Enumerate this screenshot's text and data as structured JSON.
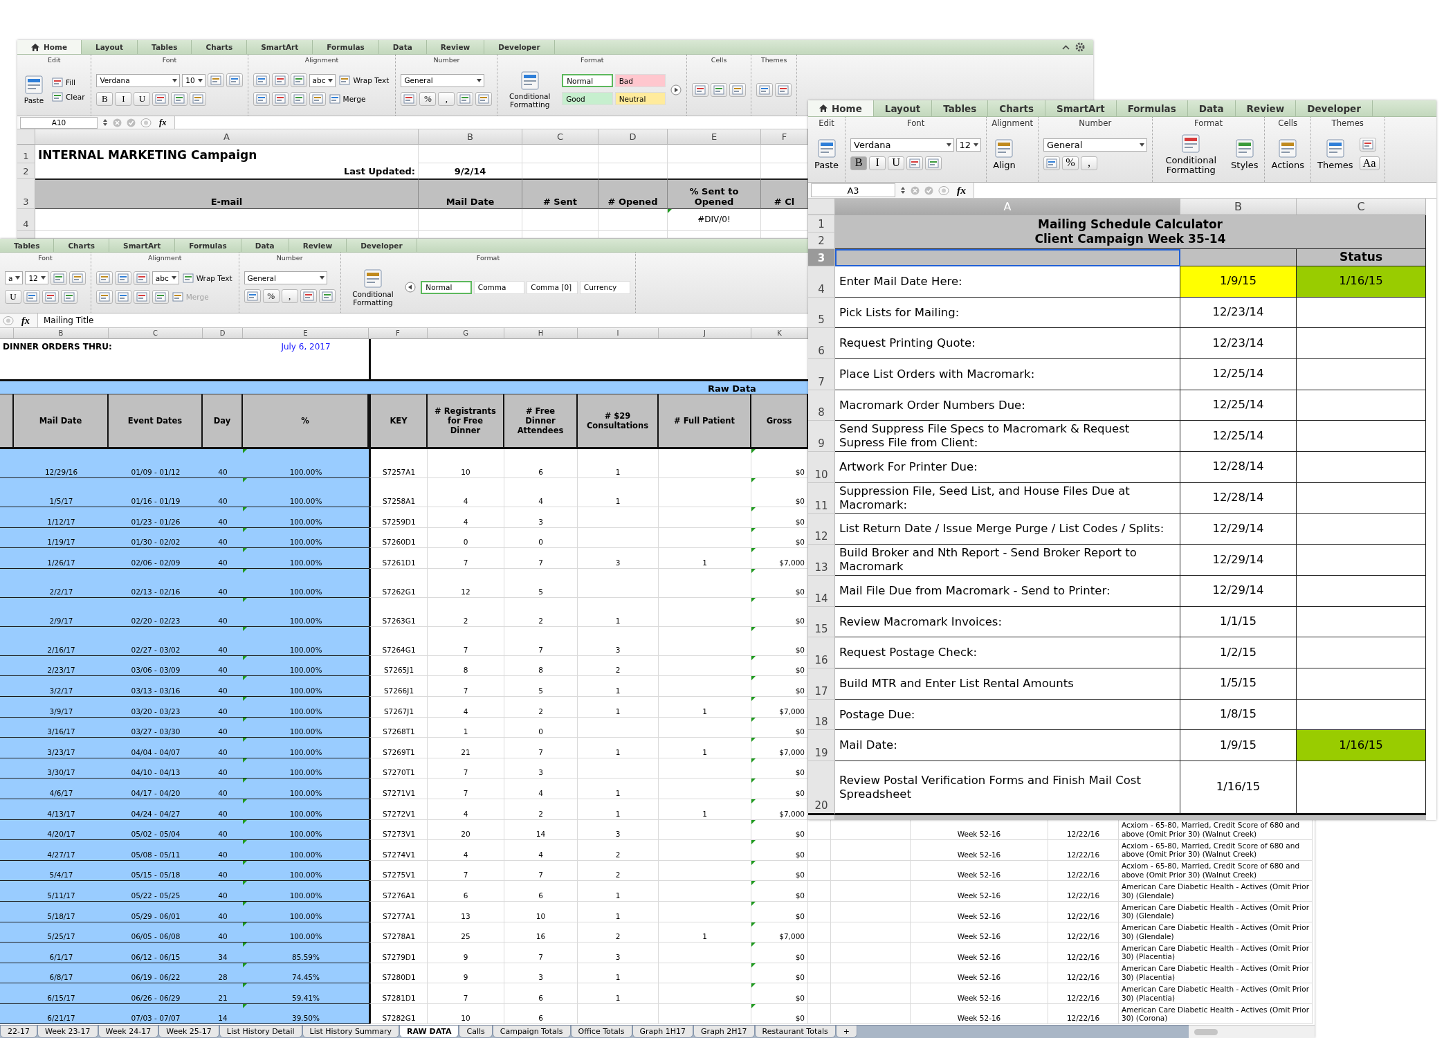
{
  "marketing_window": {
    "tabs": [
      {
        "label": "Home",
        "kind": "home",
        "selected": true
      },
      {
        "label": "Layout",
        "kind": "plain",
        "selected": false
      },
      {
        "label": "Tables",
        "kind": "plain",
        "selected": false
      },
      {
        "label": "Charts",
        "kind": "plain",
        "selected": false
      },
      {
        "label": "SmartArt",
        "kind": "plain",
        "selected": false
      },
      {
        "label": "Formulas",
        "kind": "plain",
        "selected": false
      },
      {
        "label": "Data",
        "kind": "plain",
        "selected": false
      },
      {
        "label": "Review",
        "kind": "plain",
        "selected": false
      },
      {
        "label": "Developer",
        "kind": "plain",
        "selected": false
      }
    ],
    "tab_controls": true,
    "ribbon": [
      {
        "label": "Edit",
        "parts": [
          {
            "kind": "big",
            "text": "Paste"
          },
          {
            "kind": "stack",
            "top_row": [
              {
                "kind": "small",
                "text": "Fill",
                "disabled": false
              }
            ],
            "bottom_row": [
              {
                "kind": "small",
                "text": "Clear",
                "disabled": false
              }
            ]
          }
        ]
      },
      {
        "label": "Font",
        "parts": [
          {
            "kind": "stack",
            "top_row": [
              {
                "kind": "wide_field",
                "text": "Verdana"
              },
              {
                "kind": "field",
                "text": "10"
              },
              {
                "kind": "icon"
              },
              {
                "kind": "icon"
              }
            ],
            "bottom_row": [
              {
                "kind": "glyph",
                "text": "B",
                "on": false
              },
              {
                "kind": "glyph",
                "text": "I",
                "on": false
              },
              {
                "kind": "glyph",
                "text": "U",
                "on": false
              },
              {
                "kind": "icon"
              },
              {
                "kind": "icon"
              },
              {
                "kind": "icon"
              }
            ]
          }
        ]
      },
      {
        "label": "Alignment",
        "parts": [
          {
            "kind": "stack",
            "top_row": [
              {
                "kind": "icon"
              },
              {
                "kind": "icon"
              },
              {
                "kind": "icon"
              },
              {
                "kind": "field",
                "text": "abc"
              },
              {
                "kind": "small",
                "text": "Wrap Text",
                "disabled": false
              }
            ],
            "bottom_row": [
              {
                "kind": "icon"
              },
              {
                "kind": "icon"
              },
              {
                "kind": "icon"
              },
              {
                "kind": "icon"
              },
              {
                "kind": "small",
                "text": "Merge",
                "disabled": false
              }
            ]
          }
        ]
      },
      {
        "label": "Number",
        "parts": [
          {
            "kind": "stack",
            "top_row": [
              {
                "kind": "wide_field",
                "text": "General"
              }
            ],
            "bottom_row": [
              {
                "kind": "icon"
              },
              {
                "kind": "glyph",
                "text": "%",
                "on": false
              },
              {
                "kind": "glyph",
                "text": ",",
                "on": false
              },
              {
                "kind": "icon"
              },
              {
                "kind": "icon"
              }
            ]
          }
        ]
      },
      {
        "label": "Format",
        "parts": [
          {
            "kind": "big",
            "text": "Conditional Formatting"
          },
          {
            "kind": "stack",
            "top_row": [
              {
                "kind": "style",
                "text": "Normal",
                "color": "#ffffff",
                "selected": true
              },
              {
                "kind": "style",
                "text": "Bad",
                "color": "#ffc7ce",
                "selected": false
              }
            ],
            "bottom_row": [
              {
                "kind": "style",
                "text": "Good",
                "color": "#c6efce",
                "selected": false
              },
              {
                "kind": "style",
                "text": "Neutral",
                "color": "#ffeb9c",
                "selected": false
              }
            ]
          },
          {
            "kind": "nav_next"
          }
        ]
      },
      {
        "label": "Cells",
        "parts": [
          {
            "kind": "stack",
            "top_row": [
              {
                "kind": "icon"
              },
              {
                "kind": "icon"
              },
              {
                "kind": "icon"
              }
            ]
          }
        ]
      },
      {
        "label": "Themes",
        "parts": [
          {
            "kind": "stack",
            "top_row": [
              {
                "kind": "icon"
              },
              {
                "kind": "icon"
              }
            ]
          }
        ]
      }
    ],
    "formula_bar": {
      "name_box": "A10",
      "fx": "fx"
    },
    "sheet": {
      "columns": [
        "A",
        "B",
        "C",
        "D",
        "E",
        "F"
      ],
      "rows": [
        {
          "kind": "title",
          "number": "1",
          "text": "INTERNAL MARKETING Campaign"
        },
        {
          "kind": "updated",
          "number": "2",
          "label": "Last Updated:",
          "value": "9/2/14"
        },
        {
          "kind": "header",
          "number": "3",
          "headers": [
            "E-mail",
            "Mail Date",
            "# Sent",
            "# Opened",
            "% Sent to Opened",
            "# Cl"
          ]
        },
        {
          "kind": "values",
          "number": "4",
          "sent_to_opened": "#DIV/0!",
          "error_mark": true
        }
      ]
    }
  },
  "raw_data_window": {
    "tabs": [
      {
        "label": "Tables",
        "selected": false
      },
      {
        "label": "Charts",
        "selected": false
      },
      {
        "label": "SmartArt",
        "selected": false
      },
      {
        "label": "Formulas",
        "selected": false
      },
      {
        "label": "Data",
        "selected": false
      },
      {
        "label": "Review",
        "selected": false
      },
      {
        "label": "Developer",
        "selected": false
      }
    ],
    "ribbon": [
      {
        "label": "Font",
        "parts": [
          {
            "kind": "stack",
            "top_row": [
              {
                "kind": "field",
                "text": "a"
              },
              {
                "kind": "field",
                "text": "12"
              },
              {
                "kind": "icon"
              },
              {
                "kind": "icon"
              }
            ],
            "bottom_row": [
              {
                "kind": "glyph",
                "text": "U",
                "on": false
              },
              {
                "kind": "icon"
              },
              {
                "kind": "icon"
              },
              {
                "kind": "icon"
              }
            ]
          }
        ]
      },
      {
        "label": "Alignment",
        "parts": [
          {
            "kind": "stack",
            "top_row": [
              {
                "kind": "icon"
              },
              {
                "kind": "icon"
              },
              {
                "kind": "icon"
              },
              {
                "kind": "field",
                "text": "abc"
              },
              {
                "kind": "small",
                "text": "Wrap Text",
                "disabled": false
              }
            ],
            "bottom_row": [
              {
                "kind": "icon"
              },
              {
                "kind": "icon"
              },
              {
                "kind": "icon"
              },
              {
                "kind": "icon"
              },
              {
                "kind": "small",
                "text": "Merge",
                "disabled": true
              }
            ]
          }
        ]
      },
      {
        "label": "Number",
        "parts": [
          {
            "kind": "stack",
            "top_row": [
              {
                "kind": "wide_field",
                "text": "General"
              }
            ],
            "bottom_row": [
              {
                "kind": "icon"
              },
              {
                "kind": "glyph",
                "text": "%",
                "on": false
              },
              {
                "kind": "glyph",
                "text": ",",
                "on": false
              },
              {
                "kind": "icon"
              },
              {
                "kind": "icon"
              }
            ]
          }
        ]
      },
      {
        "label": "Format",
        "parts": [
          {
            "kind": "big",
            "text": "Conditional Formatting"
          },
          {
            "kind": "nav_prev"
          },
          {
            "kind": "stack",
            "top_row": [
              {
                "kind": "style",
                "text": "Normal",
                "color": "#ffffff",
                "selected": true
              },
              {
                "kind": "style",
                "text": "Comma",
                "color": "#ffffff",
                "selected": false
              },
              {
                "kind": "style",
                "text": "Comma [0]",
                "color": "#ffffff",
                "selected": false
              },
              {
                "kind": "style",
                "text": "Currency",
                "color": "#ffffff",
                "selected": false
              }
            ]
          }
        ]
      }
    ],
    "formula_bar": {
      "fx": "fx",
      "formula": "Mailing Title"
    },
    "sheet": {
      "columns": [
        "B",
        "C",
        "D",
        "E",
        "F",
        "G",
        "H",
        "I",
        "J",
        "K"
      ],
      "title": "DINNER ORDERS THRU:",
      "date": "July 6, 2017",
      "band": "Raw Data",
      "headers": [
        "Mail Date",
        "Event Dates",
        "Day",
        "%",
        "KEY",
        "# Registrants for Free Dinner",
        "# Free Dinner Attendees",
        "# $29 Consultations",
        "# Full Patient",
        "Gross"
      ],
      "rows": [
        {
          "mail_date": "12/29/16",
          "event_dates": "01/09 - 01/12",
          "day": "40",
          "percent": "100.00%",
          "key": "S7257A1",
          "registrants": "10",
          "attendees": "6",
          "consultations": "1",
          "gross": "$0",
          "error_marks": true
        },
        {
          "mail_date": "1/5/17",
          "event_dates": "01/16 - 01/19",
          "day": "40",
          "percent": "100.00%",
          "key": "S7258A1",
          "registrants": "4",
          "attendees": "4",
          "consultations": "1",
          "gross": "$0",
          "error_marks": true
        },
        {
          "mail_date": "1/12/17",
          "event_dates": "01/23 - 01/26",
          "day": "40",
          "percent": "100.00%",
          "key": "S7259D1",
          "registrants": "4",
          "attendees": "3",
          "gross": "$0",
          "error_marks": true
        },
        {
          "mail_date": "1/19/17",
          "event_dates": "01/30 - 02/02",
          "day": "40",
          "percent": "100.00%",
          "key": "S7260D1",
          "registrants": "0",
          "attendees": "0",
          "gross": "$0",
          "error_marks": true
        },
        {
          "mail_date": "1/26/17",
          "event_dates": "02/06 - 02/09",
          "day": "40",
          "percent": "100.00%",
          "key": "S7261D1",
          "registrants": "7",
          "attendees": "7",
          "consultations": "3",
          "full_patient": "1",
          "gross": "$7,000",
          "error_marks": true
        },
        {
          "mail_date": "2/2/17",
          "event_dates": "02/13 - 02/16",
          "day": "40",
          "percent": "100.00%",
          "key": "S7262G1",
          "registrants": "12",
          "attendees": "5",
          "gross": "$0",
          "error_marks": true
        },
        {
          "mail_date": "2/9/17",
          "event_dates": "02/20 - 02/23",
          "day": "40",
          "percent": "100.00%",
          "key": "S7263G1",
          "registrants": "2",
          "attendees": "2",
          "consultations": "1",
          "gross": "$0",
          "error_marks": true
        },
        {
          "mail_date": "2/16/17",
          "event_dates": "02/27 - 03/02",
          "day": "40",
          "percent": "100.00%",
          "key": "S7264G1",
          "registrants": "7",
          "attendees": "7",
          "consultations": "3",
          "gross": "$0",
          "error_marks": true
        },
        {
          "mail_date": "2/23/17",
          "event_dates": "03/06 - 03/09",
          "day": "40",
          "percent": "100.00%",
          "key": "S7265J1",
          "registrants": "8",
          "attendees": "8",
          "consultations": "2",
          "gross": "$0",
          "error_marks": true
        },
        {
          "mail_date": "3/2/17",
          "event_dates": "03/13 - 03/16",
          "day": "40",
          "percent": "100.00%",
          "key": "S7266J1",
          "registrants": "7",
          "attendees": "5",
          "consultations": "1",
          "gross": "$0",
          "error_marks": true
        },
        {
          "mail_date": "3/9/17",
          "event_dates": "03/20 - 03/23",
          "day": "40",
          "percent": "100.00%",
          "key": "S7267J1",
          "registrants": "4",
          "attendees": "2",
          "consultations": "1",
          "full_patient": "1",
          "gross": "$7,000",
          "error_marks": true
        },
        {
          "mail_date": "3/16/17",
          "event_dates": "03/27 - 03/30",
          "day": "40",
          "percent": "100.00%",
          "key": "S7268T1",
          "registrants": "1",
          "attendees": "0",
          "gross": "$0",
          "error_marks": true
        },
        {
          "mail_date": "3/23/17",
          "event_dates": "04/04 - 04/07",
          "day": "40",
          "percent": "100.00%",
          "key": "S7269T1",
          "registrants": "21",
          "attendees": "7",
          "consultations": "1",
          "full_patient": "1",
          "gross": "$7,000",
          "error_marks": true
        },
        {
          "mail_date": "3/30/17",
          "event_dates": "04/10 - 04/13",
          "day": "40",
          "percent": "100.00%",
          "key": "S7270T1",
          "registrants": "7",
          "attendees": "3",
          "gross": "$0",
          "error_marks": true
        },
        {
          "mail_date": "4/6/17",
          "event_dates": "04/17 - 04/20",
          "day": "40",
          "percent": "100.00%",
          "key": "S7271V1",
          "registrants": "7",
          "attendees": "4",
          "consultations": "1",
          "gross": "$0",
          "error_marks": true
        },
        {
          "mail_date": "4/13/17",
          "event_dates": "04/24 - 04/27",
          "day": "40",
          "percent": "100.00%",
          "key": "S7272V1",
          "registrants": "4",
          "attendees": "2",
          "consultations": "1",
          "full_patient": "1",
          "gross": "$7,000",
          "error_marks": true
        },
        {
          "mail_date": "4/20/17",
          "event_dates": "05/02 - 05/04",
          "day": "40",
          "percent": "100.00%",
          "key": "S7273V1",
          "registrants": "20",
          "attendees": "14",
          "consultations": "3",
          "gross": "$0",
          "error_marks": true,
          "column_14": "Week 52-16",
          "column_15": "12/22/16",
          "column_16": "Acxiom - 65-80, Married, Credit Score of 680 and above (Omit Prior 30) (Walnut Creek)"
        },
        {
          "mail_date": "4/27/17",
          "event_dates": "05/08 - 05/11",
          "day": "40",
          "percent": "100.00%",
          "key": "S7274V1",
          "registrants": "4",
          "attendees": "4",
          "consultations": "2",
          "gross": "$0",
          "error_marks": true,
          "column_14": "Week 52-16",
          "column_15": "12/22/16",
          "column_16": "Acxiom - 65-80, Married, Credit Score of 680 and above (Omit Prior 30) (Walnut Creek)"
        },
        {
          "mail_date": "5/4/17",
          "event_dates": "05/15 - 05/18",
          "day": "40",
          "percent": "100.00%",
          "key": "S7275V1",
          "registrants": "7",
          "attendees": "7",
          "consultations": "2",
          "gross": "$0",
          "error_marks": true,
          "column_14": "Week 52-16",
          "column_15": "12/22/16",
          "column_16": "Acxiom - 65-80, Married, Credit Score of 680 and above (Omit Prior 30) (Walnut Creek)"
        },
        {
          "mail_date": "5/11/17",
          "event_dates": "05/22 - 05/25",
          "day": "40",
          "percent": "100.00%",
          "key": "S7276A1",
          "registrants": "6",
          "attendees": "6",
          "consultations": "1",
          "gross": "$0",
          "error_marks": true,
          "column_14": "Week 52-16",
          "column_15": "12/22/16",
          "column_16": "American Care Diabetic Health - Actives (Omit Prior 30) (Glendale)"
        },
        {
          "mail_date": "5/18/17",
          "event_dates": "05/29 - 06/01",
          "day": "40",
          "percent": "100.00%",
          "key": "S7277A1",
          "registrants": "13",
          "attendees": "10",
          "consultations": "1",
          "gross": "$0",
          "error_marks": true,
          "column_14": "Week 52-16",
          "column_15": "12/22/16",
          "column_16": "American Care Diabetic Health - Actives (Omit Prior 30) (Glendale)"
        },
        {
          "mail_date": "5/25/17",
          "event_dates": "06/05 - 06/08",
          "day": "40",
          "percent": "100.00%",
          "key": "S7278A1",
          "registrants": "25",
          "attendees": "16",
          "consultations": "2",
          "full_patient": "1",
          "gross": "$7,000",
          "error_marks": true,
          "column_14": "Week 52-16",
          "column_15": "12/22/16",
          "column_16": "American Care Diabetic Health - Actives (Omit Prior 30) (Glendale)"
        },
        {
          "mail_date": "6/1/17",
          "event_dates": "06/12 - 06/15",
          "day": "34",
          "percent": "85.59%",
          "key": "S7279D1",
          "registrants": "9",
          "attendees": "7",
          "consultations": "3",
          "gross": "$0",
          "error_marks": true,
          "column_14": "Week 52-16",
          "column_15": "12/22/16",
          "column_16": "American Care Diabetic Health - Actives (Omit Prior 30) (Placentia)"
        },
        {
          "mail_date": "6/8/17",
          "event_dates": "06/19 - 06/22",
          "day": "28",
          "percent": "74.45%",
          "key": "S7280D1",
          "registrants": "9",
          "attendees": "3",
          "consultations": "1",
          "gross": "$0",
          "error_marks": true,
          "column_14": "Week 52-16",
          "column_15": "12/22/16",
          "column_16": "American Care Diabetic Health - Actives (Omit Prior 30) (Placentia)"
        },
        {
          "mail_date": "6/15/17",
          "event_dates": "06/26 - 06/29",
          "day": "21",
          "percent": "59.41%",
          "key": "S7281D1",
          "registrants": "7",
          "attendees": "6",
          "consultations": "1",
          "gross": "$0",
          "error_marks": true,
          "column_14": "Week 52-16",
          "column_15": "12/22/16",
          "column_16": "American Care Diabetic Health - Actives (Omit Prior 30) (Placentia)"
        },
        {
          "mail_date": "6/21/17",
          "event_dates": "07/03 - 07/07",
          "day": "14",
          "percent": "39.50%",
          "key": "S7282G1",
          "registrants": "10",
          "attendees": "6",
          "gross": "$0",
          "error_marks": true,
          "column_14": "Week 52-16",
          "column_15": "12/22/16",
          "column_16": "American Care Diabetic Health - Actives (Omit Prior 30) (Corona)"
        }
      ]
    },
    "sheet_tabs": [
      {
        "label": "22-17",
        "kind": "tab",
        "selected": false
      },
      {
        "label": "Week 23-17",
        "kind": "tab",
        "selected": false
      },
      {
        "label": "Week 24-17",
        "kind": "tab",
        "selected": false
      },
      {
        "label": "Week 25-17",
        "kind": "tab",
        "selected": false
      },
      {
        "label": "List History Detail",
        "kind": "tab",
        "selected": false
      },
      {
        "label": "List History Summary",
        "kind": "tab",
        "selected": false
      },
      {
        "label": "RAW DATA",
        "kind": "tab",
        "selected": true
      },
      {
        "label": "Calls",
        "kind": "tab",
        "selected": false
      },
      {
        "label": "Campaign Totals",
        "kind": "tab",
        "selected": false
      },
      {
        "label": "Office Totals",
        "kind": "tab",
        "selected": false
      },
      {
        "label": "Graph 1H17",
        "kind": "tab",
        "selected": false
      },
      {
        "label": "Graph 2H17",
        "kind": "tab",
        "selected": false
      },
      {
        "label": "Restaurant Totals",
        "kind": "tab",
        "selected": false
      },
      {
        "label": "+",
        "kind": "add"
      }
    ]
  },
  "schedule_window": {
    "tabs": [
      {
        "label": "Home",
        "kind": "home",
        "selected": true
      },
      {
        "label": "Layout",
        "kind": "plain",
        "selected": false
      },
      {
        "label": "Tables",
        "kind": "plain",
        "selected": false
      },
      {
        "label": "Charts",
        "kind": "plain",
        "selected": false
      },
      {
        "label": "SmartArt",
        "kind": "plain",
        "selected": false
      },
      {
        "label": "Formulas",
        "kind": "plain",
        "selected": false
      },
      {
        "label": "Data",
        "kind": "plain",
        "selected": false
      },
      {
        "label": "Review",
        "kind": "plain",
        "selected": false
      },
      {
        "label": "Developer",
        "kind": "plain",
        "selected": false
      }
    ],
    "ribbon": [
      {
        "label": "Edit",
        "parts": [
          {
            "kind": "big",
            "text": "Paste"
          }
        ]
      },
      {
        "label": "Font",
        "parts": [
          {
            "kind": "stack",
            "top_row": [
              {
                "kind": "wide_field",
                "text": "Verdana"
              },
              {
                "kind": "field",
                "text": "12"
              }
            ],
            "bottom_row": [
              {
                "kind": "glyph",
                "text": "B",
                "on": true
              },
              {
                "kind": "glyph",
                "text": "I",
                "on": false
              },
              {
                "kind": "glyph",
                "text": "U",
                "on": false
              },
              {
                "kind": "icon"
              },
              {
                "kind": "icon"
              }
            ]
          }
        ]
      },
      {
        "label": "Alignment",
        "parts": [
          {
            "kind": "big",
            "text": "Align"
          }
        ]
      },
      {
        "label": "Number",
        "parts": [
          {
            "kind": "stack",
            "top_row": [
              {
                "kind": "wide_field",
                "text": "General"
              }
            ],
            "bottom_row": [
              {
                "kind": "icon"
              },
              {
                "kind": "glyph",
                "text": "%",
                "on": false
              },
              {
                "kind": "glyph",
                "text": ",",
                "on": false
              }
            ]
          }
        ]
      },
      {
        "label": "Format",
        "parts": [
          {
            "kind": "big",
            "text": "Conditional Formatting"
          },
          {
            "kind": "big",
            "text": "Styles"
          }
        ]
      },
      {
        "label": "Cells",
        "parts": [
          {
            "kind": "big",
            "text": "Actions"
          }
        ]
      },
      {
        "label": "Themes",
        "parts": [
          {
            "kind": "big",
            "text": "Themes"
          },
          {
            "kind": "stack",
            "top_row": [
              {
                "kind": "icon"
              }
            ],
            "bottom_row": [
              {
                "kind": "glyph",
                "text": "Aa",
                "on": false
              }
            ]
          }
        ]
      }
    ],
    "formula_bar": {
      "name_box": "A3",
      "fx": "fx"
    },
    "sheet": {
      "columns": [
        "A",
        "B",
        "C"
      ],
      "title_rows": [
        {
          "number": "1",
          "text": "Mailing Schedule Calculator"
        },
        {
          "number": "2",
          "text": "Client Campaign Week 35-14"
        }
      ],
      "rows": [
        {
          "kind": "header",
          "number": "3",
          "status": {
            "text": "Status"
          },
          "selected": true
        },
        {
          "kind": "item",
          "number": "4",
          "label": "Enter Mail Date Here:",
          "date": {
            "text": "1/9/15",
            "color": "#ffff00"
          },
          "status": {
            "text": "1/16/15",
            "color": "#99cc00"
          },
          "selected": false
        },
        {
          "kind": "item",
          "number": "5",
          "label": "Pick Lists for Mailing:",
          "date": {
            "text": "12/23/14"
          },
          "selected": false
        },
        {
          "kind": "item",
          "number": "6",
          "label": "Request Printing Quote:",
          "date": {
            "text": "12/23/14"
          },
          "selected": false
        },
        {
          "kind": "item",
          "number": "7",
          "label": "Place List Orders with Macromark:",
          "date": {
            "text": "12/25/14"
          },
          "selected": false
        },
        {
          "kind": "item",
          "number": "8",
          "label": "Macromark Order Numbers Due:",
          "date": {
            "text": "12/25/14"
          },
          "selected": false
        },
        {
          "kind": "item",
          "number": "9",
          "label": "Send Suppress File Specs to Macromark & Request Supress File from Client:",
          "date": {
            "text": "12/25/14"
          },
          "selected": false
        },
        {
          "kind": "item",
          "number": "10",
          "label": "Artwork For Printer Due:",
          "date": {
            "text": "12/28/14"
          },
          "selected": false
        },
        {
          "kind": "item",
          "number": "11",
          "label": "Suppression File, Seed List, and House Files Due at Macromark:",
          "date": {
            "text": "12/28/14"
          },
          "selected": false
        },
        {
          "kind": "item",
          "number": "12",
          "label": "List Return Date / Issue Merge Purge / List Codes / Splits:",
          "date": {
            "text": "12/29/14"
          },
          "selected": false
        },
        {
          "kind": "item",
          "number": "13",
          "label": "Build Broker and Nth Report - Send Broker Report to Macromark",
          "date": {
            "text": "12/29/14"
          },
          "selected": false
        },
        {
          "kind": "item",
          "number": "14",
          "label": "Mail File Due from Macromark - Send to Printer:",
          "date": {
            "text": "12/29/14"
          },
          "selected": false
        },
        {
          "kind": "item",
          "number": "15",
          "label": "Review Macromark Invoices:",
          "date": {
            "text": "1/1/15"
          },
          "selected": false
        },
        {
          "kind": "item",
          "number": "16",
          "label": "Request Postage Check:",
          "date": {
            "text": "1/2/15"
          },
          "selected": false
        },
        {
          "kind": "item",
          "number": "17",
          "label": "Build MTR and Enter List Rental Amounts",
          "date": {
            "text": "1/5/15"
          },
          "selected": false
        },
        {
          "kind": "item",
          "number": "18",
          "label": "Postage Due:",
          "date": {
            "text": "1/8/15"
          },
          "selected": false
        },
        {
          "kind": "item",
          "number": "19",
          "label": "Mail Date:",
          "date": {
            "text": "1/9/15"
          },
          "status": {
            "text": "1/16/15",
            "color": "#99cc00"
          },
          "selected": false
        },
        {
          "kind": "item",
          "number": "20",
          "label": "Review Postal Verification Forms and Finish Mail Cost Spreadsheet",
          "date": {
            "text": "1/16/15"
          },
          "selected": false
        }
      ]
    }
  }
}
